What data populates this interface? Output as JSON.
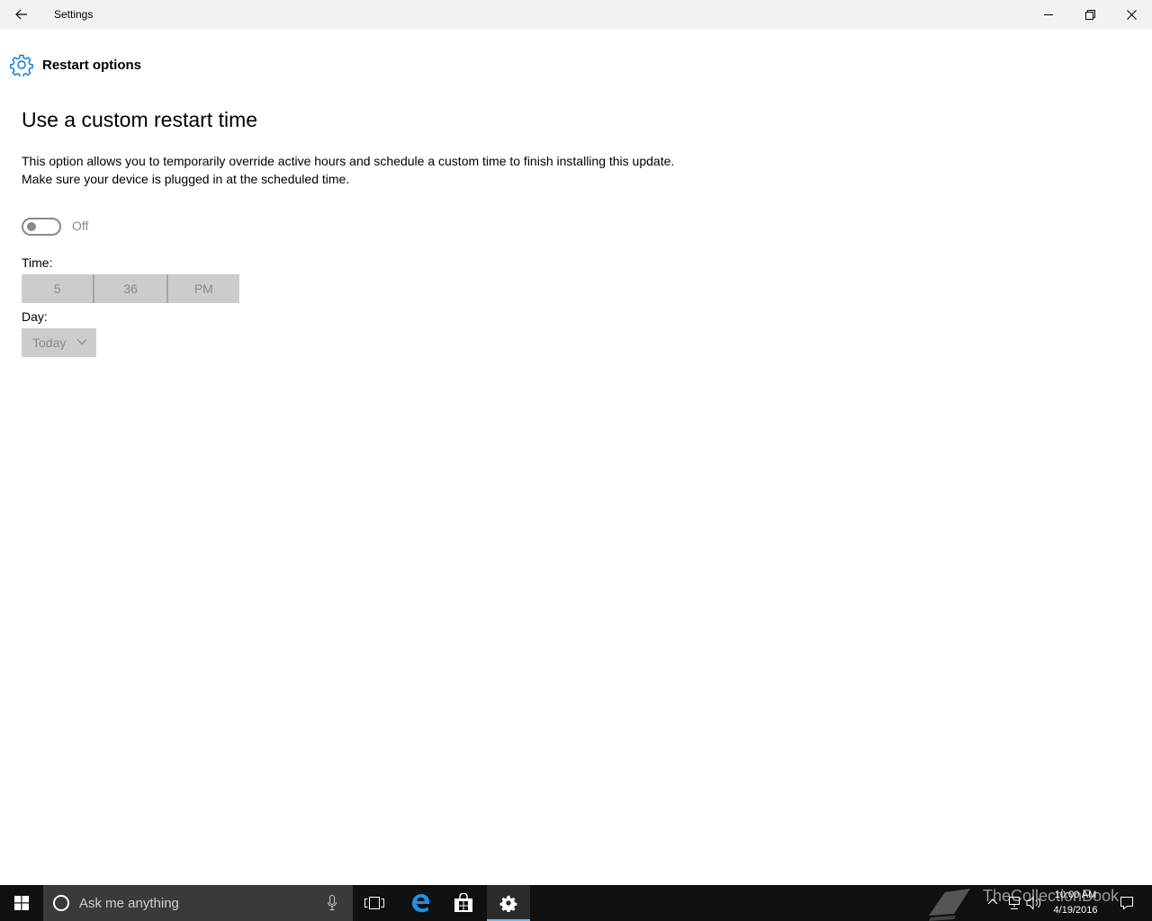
{
  "window": {
    "title": "Settings"
  },
  "page": {
    "header_title": "Restart options",
    "section_title": "Use a custom restart time",
    "description_line1": "This option allows you to temporarily override active hours and schedule a custom time to finish installing this update.",
    "description_line2": "Make sure your device is plugged in at the scheduled time.",
    "toggle": {
      "state": "off",
      "label": "Off"
    },
    "time": {
      "label": "Time:",
      "hour": "5",
      "minute": "36",
      "period": "PM"
    },
    "day": {
      "label": "Day:",
      "selected": "Today"
    },
    "accent_color": "#0078d7"
  },
  "taskbar": {
    "search_placeholder": "Ask me anything",
    "watermark": "TheCollectionBook",
    "clock_time": "10:00 AM",
    "clock_date": "4/19/2016"
  }
}
